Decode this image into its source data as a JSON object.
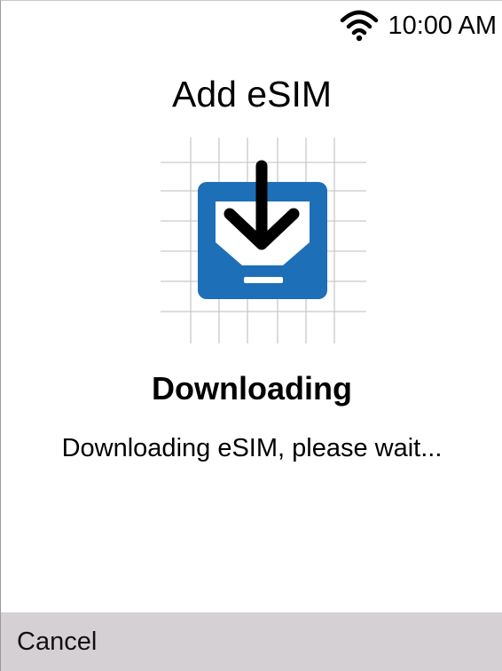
{
  "status_bar": {
    "wifi_icon": "wifi-icon",
    "time": "10:00 AM"
  },
  "screen": {
    "title": "Add eSIM",
    "illustration_icon": "download-tray-icon",
    "illustration_color": "#1d6fb8",
    "heading": "Downloading",
    "message": "Downloading eSIM, please wait..."
  },
  "softkeys": {
    "left_label": "Cancel",
    "bar_color": "#d5d0d4"
  }
}
